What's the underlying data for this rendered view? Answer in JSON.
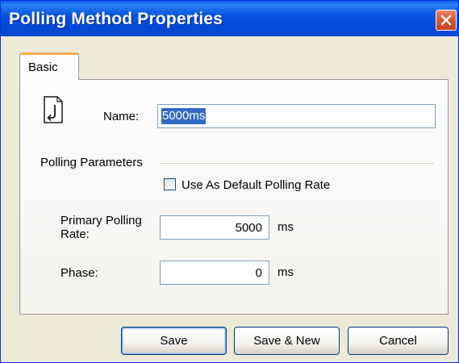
{
  "window": {
    "title": "Polling Method Properties",
    "close_icon": "close-icon"
  },
  "tabs": [
    {
      "label": "Basic",
      "active": true
    }
  ],
  "form": {
    "name_label": "Name:",
    "name_value": "5000ms",
    "name_icon": "document-icon",
    "group_title": "Polling Parameters",
    "default_checkbox_label": "Use As Default Polling Rate",
    "default_checkbox_checked": false,
    "primary_label": "Primary Polling Rate:",
    "primary_value": "5000",
    "primary_unit": "ms",
    "phase_label": "Phase:",
    "phase_value": "0",
    "phase_unit": "ms"
  },
  "buttons": {
    "save": "Save",
    "save_new": "Save & New",
    "cancel": "Cancel"
  },
  "colors": {
    "titlebar": "#0a55e0",
    "close_button": "#d95a32",
    "tab_accent": "#f5a94b",
    "selection": "#316ac5"
  }
}
